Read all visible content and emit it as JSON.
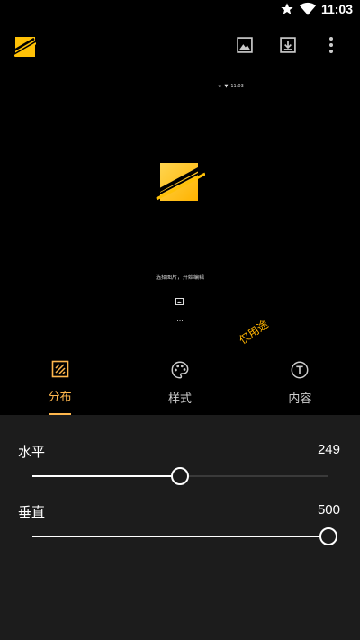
{
  "status_bar": {
    "time": "11:03",
    "icons": [
      "star-icon",
      "wifi-icon"
    ]
  },
  "app_bar": {
    "logo": "app-logo-icon",
    "actions": [
      "image-icon",
      "download-icon",
      "more-vert-icon"
    ]
  },
  "preview": {
    "mini_status_time": "11:03",
    "hint_text": "选择图片，开始编辑",
    "dots": "...",
    "watermark_text": "仅用途"
  },
  "tabs": [
    {
      "label": "分布",
      "icon": "grid-texture-icon",
      "active": true
    },
    {
      "label": "样式",
      "icon": "palette-icon",
      "active": false
    },
    {
      "label": "内容",
      "icon": "text-format-icon",
      "active": false
    }
  ],
  "settings": {
    "horizontal": {
      "label": "水平",
      "value": "249",
      "fraction": 0.498
    },
    "vertical": {
      "label": "垂直",
      "value": "500",
      "fraction": 1.0
    }
  },
  "colors": {
    "accent": "#ffb74d",
    "logo_yellow": "#ffc107",
    "panel_bg": "#1c1c1c"
  }
}
